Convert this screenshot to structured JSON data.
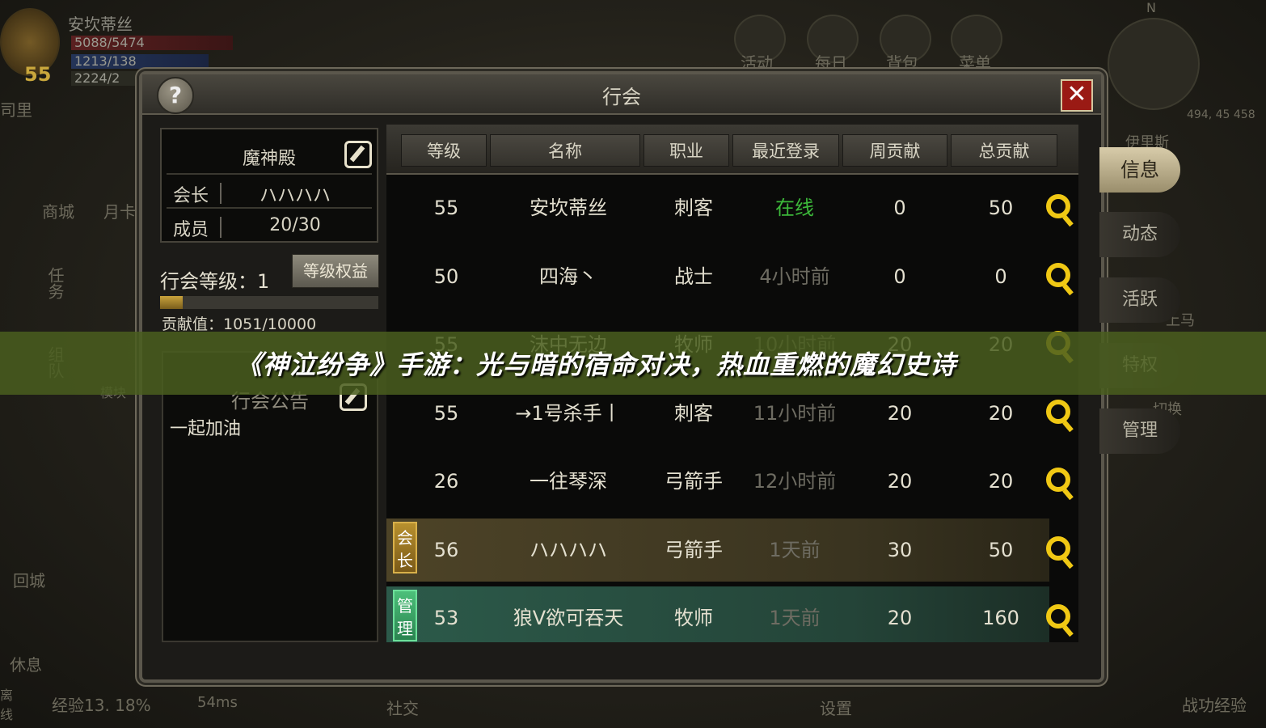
{
  "hud": {
    "player_name": "安坎蒂丝",
    "hp": "5088/5474",
    "mp": "1213/138",
    "xp_short": "2224/2",
    "level": "55",
    "side_fragment": "司里",
    "top_icons": [
      "活动",
      "每日",
      "背包",
      "菜单"
    ],
    "compass": "N",
    "coords": "494, 45 458",
    "left_icons": [
      "商城",
      "月卡",
      "任务",
      "组队",
      "回城",
      "休息",
      "模块"
    ],
    "right_labels": [
      "伊里斯",
      "上马",
      "切换"
    ],
    "bottom": {
      "exp": "经验13. 18%",
      "ping": "54ms",
      "social": "社交",
      "settings": "设置",
      "battle": "战功经验",
      "left_edge": "离线"
    }
  },
  "window": {
    "title": "行会",
    "help_label": "?",
    "close_label": "✕"
  },
  "guild": {
    "name": "魔神殿",
    "leader_label": "会长",
    "leader_value": "ハハハハ",
    "members_label": "成员",
    "members_value": "20/30",
    "level_text": "行会等级：1",
    "perk_button": "等级权益",
    "contribution_text": "贡献值：1051/10000",
    "contribution_progress": 0.1051,
    "notice_title": "行会公告",
    "notice_text": "一起加油"
  },
  "table": {
    "headers": [
      "等级",
      "名称",
      "职业",
      "最近登录",
      "周贡献",
      "总贡献"
    ],
    "rows": [
      {
        "level": "55",
        "name": "安坎蒂丝",
        "job": "刺客",
        "login": "在线",
        "weekly": "0",
        "total": "50",
        "role": ""
      },
      {
        "level": "50",
        "name": "四海丶",
        "job": "战士",
        "login": "4小时前",
        "weekly": "0",
        "total": "0",
        "role": ""
      },
      {
        "level": "55",
        "name": "沫中无边",
        "job": "牧师",
        "login": "10小时前",
        "weekly": "20",
        "total": "20",
        "role": ""
      },
      {
        "level": "55",
        "name": "→1号杀手丨",
        "job": "刺客",
        "login": "11小时前",
        "weekly": "20",
        "total": "20",
        "role": ""
      },
      {
        "level": "26",
        "name": "一往琴深",
        "job": "弓箭手",
        "login": "12小时前",
        "weekly": "20",
        "total": "20",
        "role": ""
      },
      {
        "level": "56",
        "name": "ハハハハ",
        "job": "弓箭手",
        "login": "1天前",
        "weekly": "30",
        "total": "50",
        "role": "会长"
      },
      {
        "level": "53",
        "name": "狼V欲可吞天",
        "job": "牧师",
        "login": "1天前",
        "weekly": "20",
        "total": "160",
        "role": "管理"
      }
    ]
  },
  "side_tabs": [
    "信息",
    "动态",
    "活跃",
    "特权",
    "管理"
  ],
  "banner": "《神泣纷争》手游：光与暗的宿命对决，热血重燃的魔幻史诗",
  "colors": {
    "online": "#3cb83a",
    "accent_gold": "#f0c814",
    "banner": "#4a5e1e",
    "close": "#9a1a14"
  }
}
